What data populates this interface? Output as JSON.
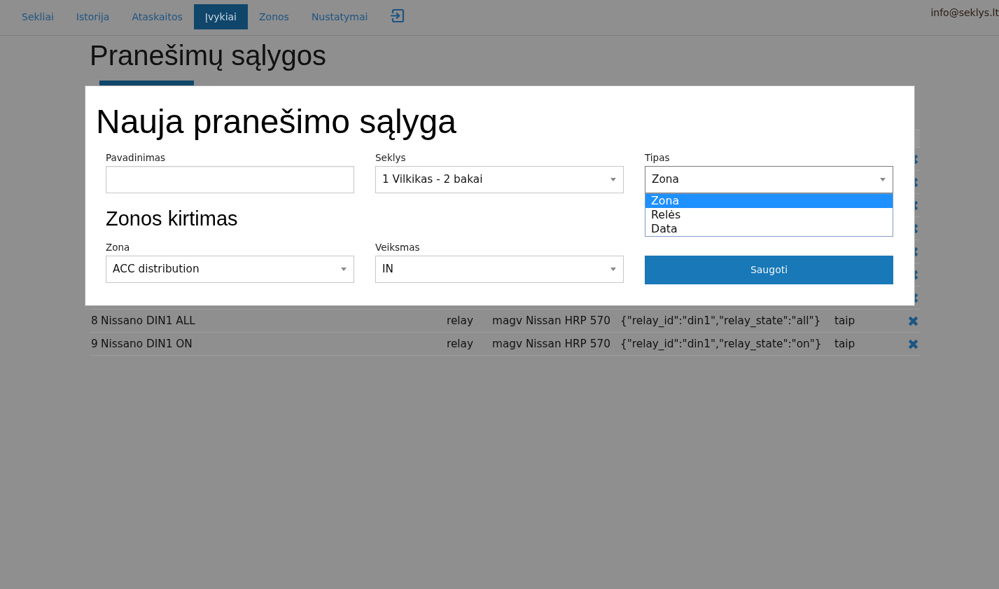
{
  "navbar": {
    "items": [
      {
        "label": "Sekliai",
        "selected": false
      },
      {
        "label": "Istorija",
        "selected": false
      },
      {
        "label": "Ataskaitos",
        "selected": false
      },
      {
        "label": "Įvykiai",
        "selected": true
      },
      {
        "label": "Zonos",
        "selected": false
      },
      {
        "label": "Nustatymai",
        "selected": false
      }
    ],
    "user": "info@seklys.lt"
  },
  "page": {
    "title": "Pranešimų sąlygos"
  },
  "table": {
    "rows": [
      {
        "covered": true
      },
      {
        "covered": true
      },
      {
        "covered": true
      },
      {
        "covered": true
      },
      {
        "covered": true
      },
      {
        "covered": true
      },
      {
        "covered": true
      },
      {
        "covered": false,
        "cells": [
          "8",
          "Nissano DIN1 ALL",
          "relay",
          "magv Nissan HRP 570",
          "{\"relay_id\":\"din1\",\"relay_state\":\"all\"}",
          "taip"
        ]
      },
      {
        "covered": false,
        "cells": [
          "9",
          "Nissano DIN1 ON",
          "relay",
          "magv Nissan HRP 570",
          "{\"relay_id\":\"din1\",\"relay_state\":\"on\"}",
          "taip"
        ]
      }
    ]
  },
  "modal": {
    "title": "Nauja pranešimo sąlyga",
    "fields": [
      {
        "kind": "text",
        "label": "Pavadinimas"
      },
      {
        "kind": "select",
        "label": "Seklys",
        "value": "1 Vilkikas - 2 bakai",
        "expanded": false
      },
      {
        "kind": "select",
        "label": "Tipas",
        "value": "Zona",
        "expanded": true,
        "options": [
          {
            "label": "Zona",
            "selected": true
          },
          {
            "label": "Relės",
            "selected": false
          },
          {
            "label": "Data",
            "selected": false
          }
        ]
      }
    ],
    "section_title": "Zonos kirtimas",
    "section_fields": [
      {
        "kind": "select",
        "label": "Zona",
        "value": "ACC distribution",
        "expanded": false
      },
      {
        "kind": "select",
        "label": "Veiksmas",
        "value": "IN",
        "expanded": false
      }
    ],
    "save_button": "Saugoti"
  }
}
